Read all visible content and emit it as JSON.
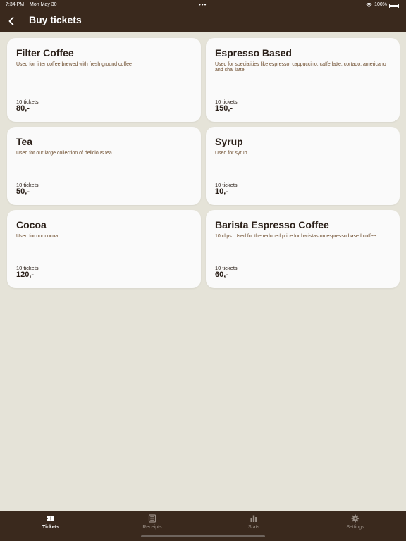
{
  "status_bar": {
    "time": "7:34 PM",
    "date": "Mon May 30",
    "battery": "100%",
    "icons": [
      "wifi-icon",
      "battery-icon"
    ]
  },
  "nav": {
    "title": "Buy tickets",
    "back_icon": "chevron-left-icon"
  },
  "tickets": [
    {
      "title": "Filter Coffee",
      "description": "Used for filter coffee brewed with fresh ground coffee",
      "count": "10 tickets",
      "price": "80,-"
    },
    {
      "title": "Espresso Based",
      "description": "Used for specialities like espresso, cappuccino, caffe latte, cortado, americano and chai latte",
      "count": "10 tickets",
      "price": "150,-"
    },
    {
      "title": "Tea",
      "description": "Used for our large collection of delicious tea",
      "count": "10 tickets",
      "price": "50,-"
    },
    {
      "title": "Syrup",
      "description": "Used for syrup",
      "count": "10 tickets",
      "price": "10,-"
    },
    {
      "title": "Cocoa",
      "description": "Used for our cocoa",
      "count": "10 tickets",
      "price": "120,-"
    },
    {
      "title": "Barista Espresso Coffee",
      "description": "10 clips. Used for the reduced price for baristas on espresso based coffee",
      "count": "10 tickets",
      "price": "60,-"
    }
  ],
  "tab_bar": {
    "items": [
      {
        "label": "Tickets",
        "icon": "ticket-icon",
        "active": true
      },
      {
        "label": "Receipts",
        "icon": "receipt-icon",
        "active": false
      },
      {
        "label": "Stats",
        "icon": "bar-chart-icon",
        "active": false
      },
      {
        "label": "Settings",
        "icon": "gear-icon",
        "active": false
      }
    ]
  },
  "colors": {
    "bar": "#3a291d",
    "background": "#e5e3d8",
    "card": "#fafafa",
    "description": "#6b4a2a"
  }
}
